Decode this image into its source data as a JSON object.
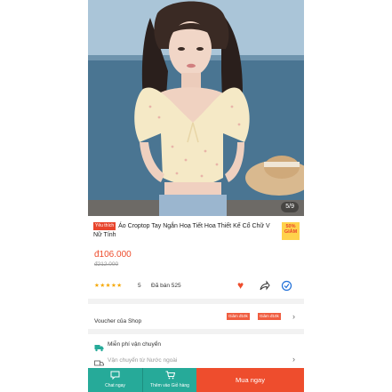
{
  "product": {
    "image_counter": "5/9",
    "favorite_tag": "Yêu thích",
    "title": "Áo Croptop Tay Ngắn Hoạ Tiết Hoa Thiết Kế Cổ Chữ V Nữ Tính",
    "discount_badge": "50% GIẢM",
    "price": "đ106.000",
    "old_price": "đ212.000",
    "rating_stars": "★★★★★",
    "rating": "5",
    "sold": "Đã bán 525"
  },
  "icons": {
    "heart": "heart-icon",
    "share": "share-icon",
    "message": "chat-bubble-icon",
    "truck": "truck-icon",
    "chat": "chat-icon",
    "cart": "cart-icon"
  },
  "voucher": {
    "label": "Voucher của Shop",
    "tags": [
      "Giảm đ10k",
      "Giảm đ10k"
    ]
  },
  "shipping": {
    "free_shipping": "Miễn phí vận chuyển",
    "ship_from": "Vận chuyển từ Nước ngoài"
  },
  "bottom_bar": {
    "chat_label": "Chat ngay",
    "cart_label": "Thêm vào Giỏ hàng",
    "buy_label": "Mua ngay"
  },
  "colors": {
    "brand": "#ee4d2d",
    "teal": "#26aa99",
    "star": "#f6a700"
  }
}
